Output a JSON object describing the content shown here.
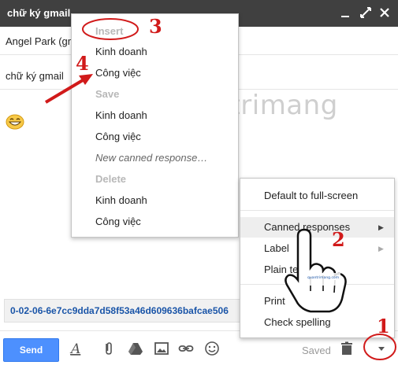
{
  "window": {
    "title": "chữ ký gmail"
  },
  "compose": {
    "to_value": "Angel Park (gm",
    "subject_value": "chữ ký gmail",
    "body_hash": "0-02-06-6e7cc9dda7d58f53a46d609636bafcae506"
  },
  "watermark": {
    "text": "uantrimang"
  },
  "insert_menu": {
    "insert_header": "Insert",
    "insert_items": [
      "Kinh doanh",
      "Công việc"
    ],
    "save_header": "Save",
    "save_items": [
      "Kinh doanh",
      "Công việc"
    ],
    "new_canned": "New canned response…",
    "delete_header": "Delete",
    "delete_items": [
      "Kinh doanh",
      "Công việc"
    ]
  },
  "more_menu": {
    "items": [
      "Default to full-screen",
      "Canned responses",
      "Label",
      "Plain te",
      "Print",
      "Check spelling"
    ]
  },
  "toolbar": {
    "send_label": "Send",
    "saved_label": "Saved"
  },
  "annotations": {
    "step_1": "1",
    "step_2": "2",
    "step_3": "3",
    "step_4": "4"
  },
  "colors": {
    "titlebar": "#404040",
    "send_button": "#4d90fe",
    "annotation_red": "#d11a1a",
    "link_blue": "#1a55a8"
  }
}
